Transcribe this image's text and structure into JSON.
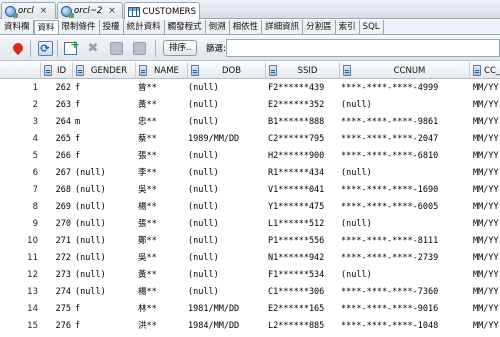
{
  "doc_tabs": [
    {
      "label": "orcl",
      "icon": "database-connection-icon"
    },
    {
      "label": "orcl~2",
      "icon": "database-connection-icon"
    },
    {
      "label": "CUSTOMERS",
      "icon": "table-grid-icon"
    }
  ],
  "close_glyph": "×",
  "sub_tabs": [
    "資料欄",
    "資料",
    "限制條件",
    "授權",
    "統計資料",
    "觸發程式",
    "倒溯",
    "相依性",
    "詳細資訊",
    "分割區",
    "索引",
    "SQL"
  ],
  "active_sub_tab": "資料",
  "toolbar": {
    "sort_label": "排序..",
    "filter_label": "篩選:",
    "filter_value": ""
  },
  "columns": [
    "ID",
    "GENDER",
    "NAME",
    "DOB",
    "SSID",
    "CCNUM",
    "CC_V"
  ],
  "rows": [
    {
      "n": "1",
      "id": "262",
      "gender": "f",
      "name": "曾**",
      "dob": "(null)",
      "ssid": "F2******439",
      "cc": "****-****-****-4999",
      "ccv": "MM/YY"
    },
    {
      "n": "2",
      "id": "263",
      "gender": "f",
      "name": "黃**",
      "dob": "(null)",
      "ssid": "E2******352",
      "cc": "(null)",
      "ccv": "MM/YY"
    },
    {
      "n": "3",
      "id": "264",
      "gender": "m",
      "name": "忠**",
      "dob": "(null)",
      "ssid": "B1******888",
      "cc": "****-****-****-9861",
      "ccv": "MM/YY"
    },
    {
      "n": "4",
      "id": "265",
      "gender": "f",
      "name": "蔡**",
      "dob": "1989/MM/DD",
      "ssid": "C2******795",
      "cc": "****-****-****-2047",
      "ccv": "MM/YY"
    },
    {
      "n": "5",
      "id": "266",
      "gender": "f",
      "name": "張**",
      "dob": "(null)",
      "ssid": "H2******900",
      "cc": "****-****-****-6810",
      "ccv": "MM/YY"
    },
    {
      "n": "6",
      "id": "267",
      "gender": "(null)",
      "name": "李**",
      "dob": "(null)",
      "ssid": "R1******434",
      "cc": "(null)",
      "ccv": "MM/YY"
    },
    {
      "n": "7",
      "id": "268",
      "gender": "(null)",
      "name": "吳**",
      "dob": "(null)",
      "ssid": "V1******041",
      "cc": "****-****-****-1690",
      "ccv": "MM/YY"
    },
    {
      "n": "8",
      "id": "269",
      "gender": "(null)",
      "name": "楊**",
      "dob": "(null)",
      "ssid": "Y1******475",
      "cc": "****-****-****-6005",
      "ccv": "MM/YY"
    },
    {
      "n": "9",
      "id": "270",
      "gender": "(null)",
      "name": "張**",
      "dob": "(null)",
      "ssid": "L1******512",
      "cc": "(null)",
      "ccv": "MM/YY"
    },
    {
      "n": "10",
      "id": "271",
      "gender": "(null)",
      "name": "鄭**",
      "dob": "(null)",
      "ssid": "P1******556",
      "cc": "****-****-****-8111",
      "ccv": "MM/YY"
    },
    {
      "n": "11",
      "id": "272",
      "gender": "(null)",
      "name": "吳**",
      "dob": "(null)",
      "ssid": "N1******942",
      "cc": "****-****-****-2739",
      "ccv": "MM/YY"
    },
    {
      "n": "12",
      "id": "273",
      "gender": "(null)",
      "name": "黃**",
      "dob": "(null)",
      "ssid": "F1******534",
      "cc": "(null)",
      "ccv": "MM/YY"
    },
    {
      "n": "13",
      "id": "274",
      "gender": "(null)",
      "name": "楊**",
      "dob": "(null)",
      "ssid": "C1******306",
      "cc": "****-****-****-7360",
      "ccv": "MM/YY"
    },
    {
      "n": "14",
      "id": "275",
      "gender": "f",
      "name": "林**",
      "dob": "1981/MM/DD",
      "ssid": "E2******165",
      "cc": "****-****-****-9016",
      "ccv": "MM/YY"
    },
    {
      "n": "15",
      "id": "276",
      "gender": "f",
      "name": "洪**",
      "dob": "1984/MM/DD",
      "ssid": "L2******885",
      "cc": "****-****-****-1048",
      "ccv": "MM/YY"
    }
  ]
}
